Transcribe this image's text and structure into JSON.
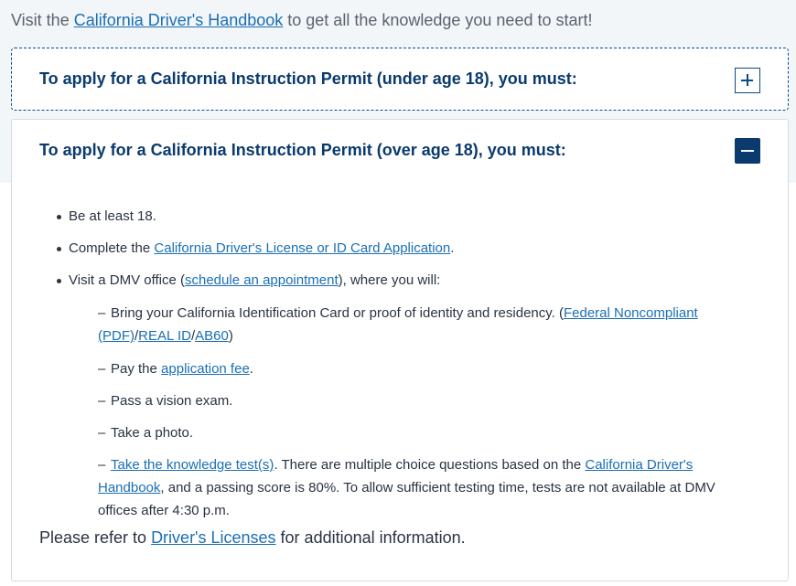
{
  "intro": {
    "prefix": "Visit the ",
    "link": "California Driver's Handbook",
    "suffix": " to get all the knowledge you need to start!"
  },
  "accordion_under18": {
    "title": "To apply for a California Instruction Permit (under age 18), you must:",
    "toggle_icon": "plus-icon"
  },
  "accordion_over18": {
    "title": "To apply for a California Instruction Permit (over age 18), you must:",
    "toggle_icon": "minus-icon",
    "items": {
      "age": "Be at least 18.",
      "complete_prefix": "Complete the ",
      "complete_link": "California Driver's License or ID Card Application",
      "complete_suffix": ".",
      "visit_prefix": "Visit a DMV office (",
      "visit_link": "schedule an appointment",
      "visit_suffix": "), where you will:"
    },
    "subitems": {
      "bring_prefix": "Bring your California Identification Card or proof of identity and residency. (",
      "bring_link1": "Federal Noncompliant (PDF)",
      "sep": "/",
      "bring_link2": "REAL ID",
      "bring_link3": "AB60",
      "bring_suffix": ")",
      "pay_prefix": "Pay the ",
      "pay_link": "application fee",
      "pay_suffix": ".",
      "vision": "Pass a vision exam.",
      "photo": "Take a photo.",
      "test_link": "Take the knowledge test(s)",
      "test_middle": ". There are multiple choice questions based on the ",
      "test_link2": "California Driver's Handbook",
      "test_suffix": ", and a passing score is 80%. To allow sufficient testing time, tests are not available at DMV offices after 4:30 p.m.",
      "dash": "–"
    },
    "footer_prefix": "Please refer to ",
    "footer_link": "Driver's Licenses",
    "footer_suffix": " for additional information."
  },
  "colors": {
    "heading": "#0b3a6e",
    "link": "#1a6fb5",
    "body": "#2a3342"
  }
}
